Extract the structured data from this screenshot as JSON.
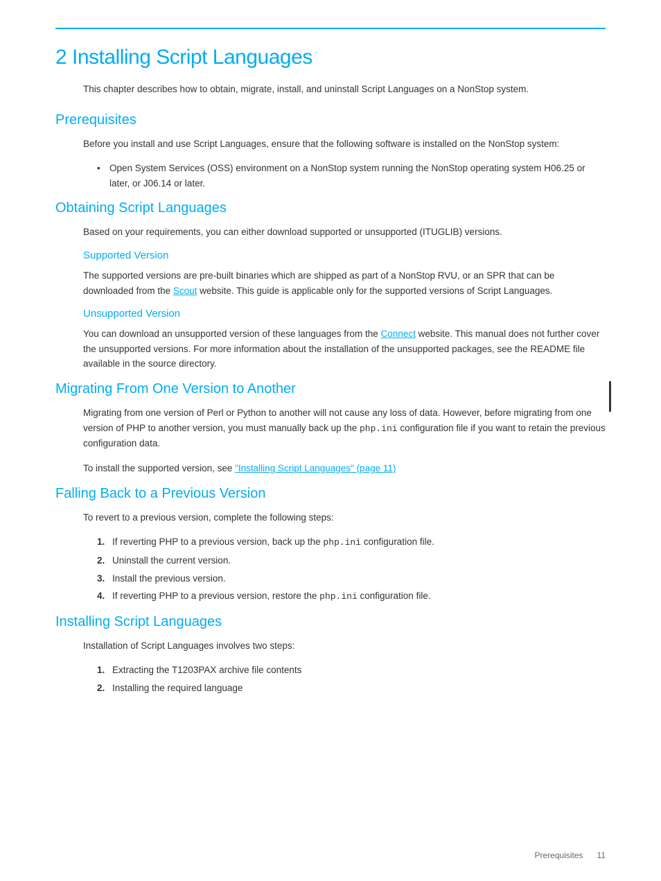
{
  "page": {
    "top_rule": true,
    "chapter_title": "2 Installing Script Languages",
    "intro_text": "This chapter describes how to obtain, migrate, install, and uninstall Script Languages on a NonStop system.",
    "sections": [
      {
        "id": "prerequisites",
        "title": "Prerequisites",
        "body": "Before you install and use Script Languages, ensure that the following software is installed on the NonStop system:",
        "bullets": [
          "Open System Services (OSS) environment on a NonStop system running the NonStop operating system H06.25 or later, or J06.14 or later."
        ]
      },
      {
        "id": "obtaining",
        "title": "Obtaining Script Languages",
        "body": "Based on your requirements, you can either download supported or unsupported (ITUGLIB) versions.",
        "subsections": [
          {
            "id": "supported-version",
            "title": "Supported Version",
            "body_parts": [
              "The supported versions are pre-built binaries which are shipped as part of a NonStop RVU, or an SPR that can be downloaded from the ",
              "Scout",
              " website. This guide is applicable only for the supported versions of Script Languages."
            ],
            "link_text": "Scout",
            "link_href": "#"
          },
          {
            "id": "unsupported-version",
            "title": "Unsupported Version",
            "body_parts": [
              "You can download an unsupported version of these languages from the ",
              "Connect",
              " website. This manual does not further cover the unsupported versions. For more information about the installation of the unsupported packages, see the README file available in the source directory."
            ],
            "link_text": "Connect",
            "link_href": "#"
          }
        ]
      },
      {
        "id": "migrating",
        "title": "Migrating From One Version to Another",
        "body1": "Migrating from one version of Perl or Python to another will not cause any loss of data. However, before migrating from one version of PHP to another version, you must manually back up the ",
        "body1_mono": "php.ini",
        "body1_end": " configuration file if you want to retain the previous configuration data.",
        "body2_prefix": "To install the supported version, see ",
        "body2_link": "\"Installing Script Languages\" (page 11)",
        "has_change_bar": true
      },
      {
        "id": "falling-back",
        "title": "Falling Back to a Previous Version",
        "intro": "To revert to a previous version, complete the following steps:",
        "steps": [
          {
            "text_prefix": "If reverting PHP to a previous version, back up the ",
            "text_mono": "php.ini",
            "text_suffix": " configuration file."
          },
          {
            "text": "Uninstall the current version."
          },
          {
            "text": "Install the previous version."
          },
          {
            "text_prefix": "If reverting PHP to a previous version, restore the ",
            "text_mono": "php.ini",
            "text_suffix": " configuration file."
          }
        ]
      },
      {
        "id": "installing",
        "title": "Installing Script Languages",
        "intro": "Installation of Script Languages involves two steps:",
        "steps": [
          {
            "text": "Extracting the T1203PAX archive file contents"
          },
          {
            "text": "Installing the required language"
          }
        ]
      }
    ],
    "footer": {
      "left_label": "Prerequisites",
      "page_number": "11"
    }
  }
}
